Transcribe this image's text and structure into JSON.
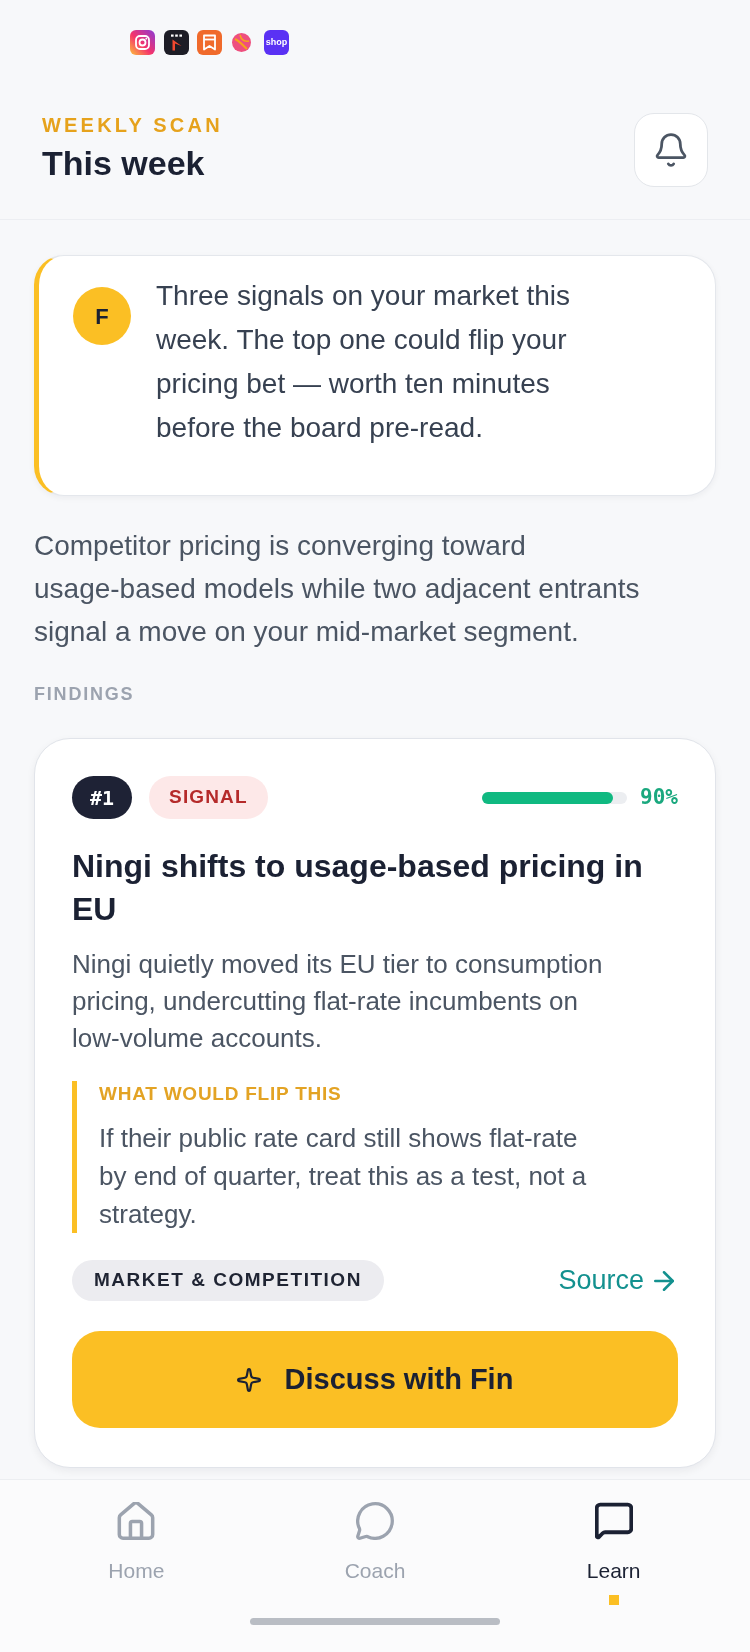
{
  "status_bar": {
    "shop_icon_label": "shop"
  },
  "header": {
    "eyebrow": "WEEKLY SCAN",
    "title": "This week"
  },
  "coach_note": {
    "avatar": "F",
    "text": "Three signals on your market this week. The top one could flip your pricing bet — worth ten minutes before the board pre-read."
  },
  "summary": "Competitor pricing is converging toward usage-based models while two adjacent entrants signal a move on your mid-market segment.",
  "findings_label": "FINDINGS",
  "findings": [
    {
      "rank": "#1",
      "badge": "SIGNAL",
      "confidence": {
        "level": 0.9,
        "reading": "90%"
      },
      "title": "Ningi shifts to usage-based pricing in EU",
      "description": "Ningi quietly moved its EU tier to consumption pricing, undercutting flat-rate incumbents on low-volume accounts.",
      "flip": {
        "label": "WHAT WOULD FLIP THIS",
        "text": "If their public rate card still shows flat-rate by end of quarter, treat this as a test, not a strategy."
      },
      "tag": "MARKET & COMPETITION",
      "source_link": "Source",
      "action_button": "Discuss with Fin"
    }
  ],
  "nav": {
    "items": [
      {
        "label": "Home",
        "selected": false
      },
      {
        "label": "Coach",
        "selected": false
      },
      {
        "label": "Learn",
        "selected": true
      }
    ]
  }
}
